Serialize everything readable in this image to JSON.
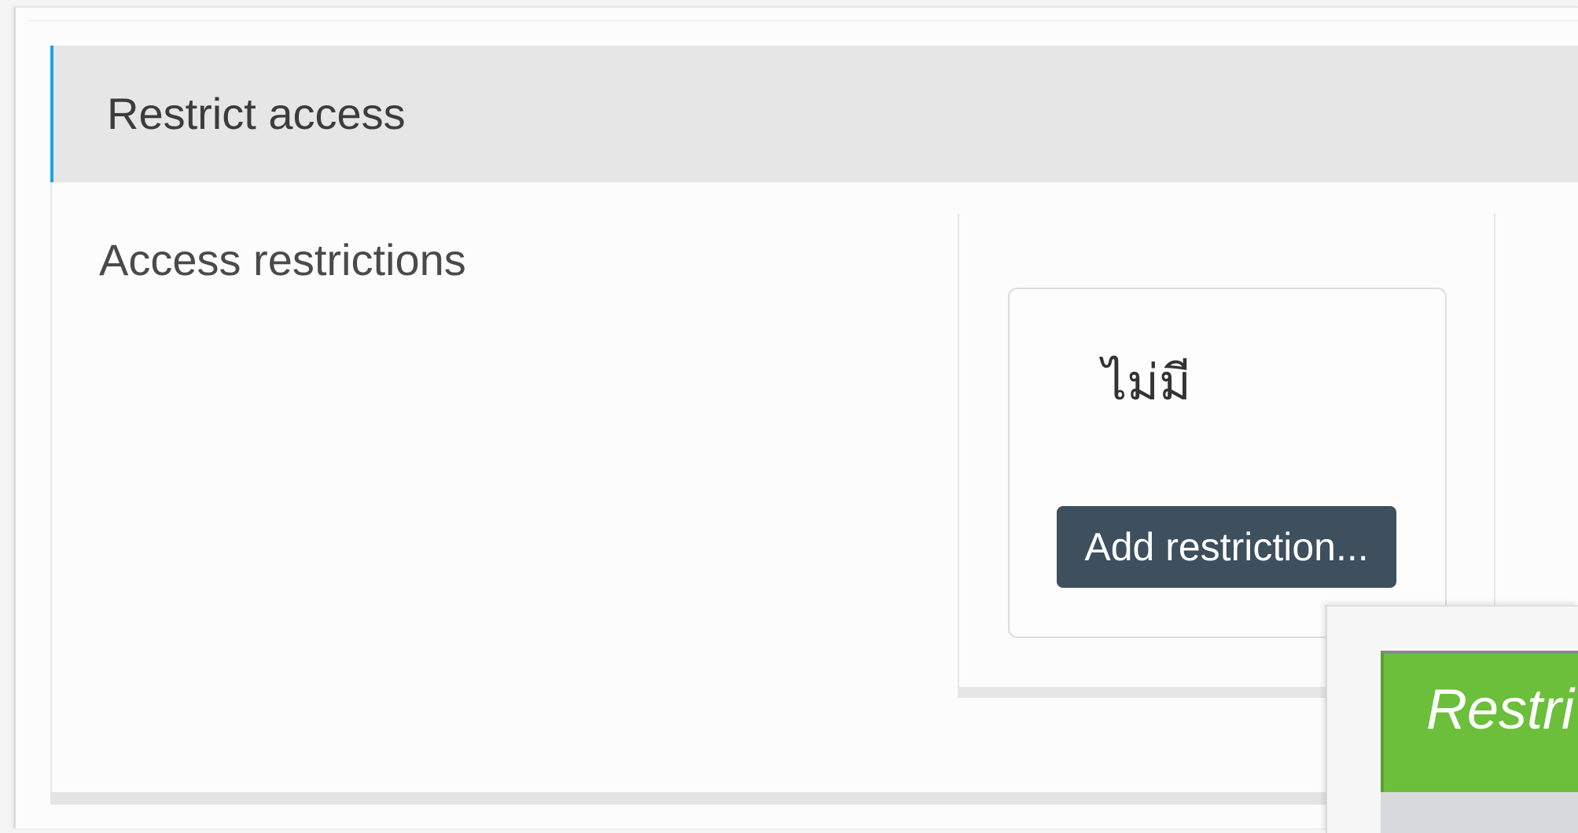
{
  "section": {
    "title": "Restrict access",
    "field_label": "Access restrictions"
  },
  "restrictions": {
    "none_text": "ไม่มี",
    "add_button_label": "Add restriction..."
  },
  "dialog": {
    "title": "Restri"
  },
  "colors": {
    "section_accent": "#1fa2e0",
    "button_bg": "#3e4f5e",
    "dialog_header_bg": "#6bbf3b"
  }
}
